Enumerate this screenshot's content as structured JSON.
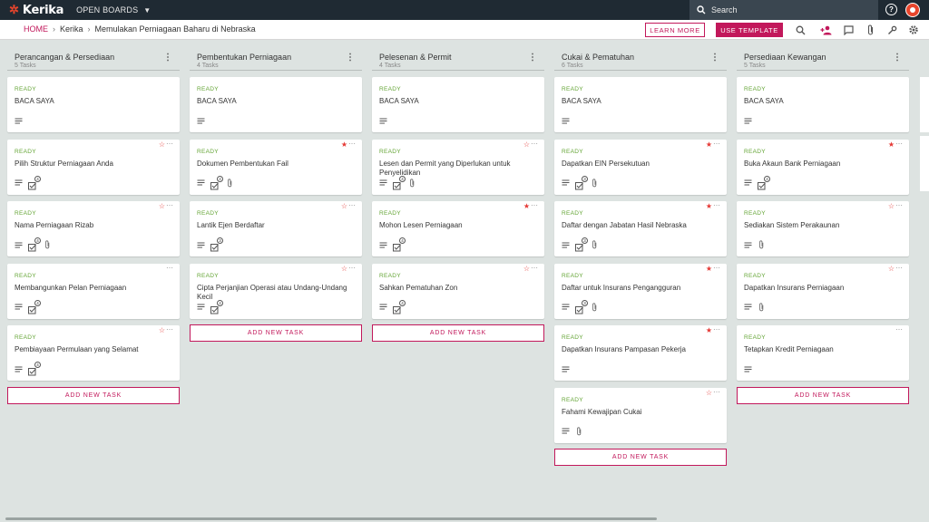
{
  "topbar": {
    "logo": "Kerika",
    "open_boards": "OPEN BOARDS",
    "search_label": "Search",
    "help": "?"
  },
  "breadcrumb": {
    "home": "HOME",
    "org": "Kerika",
    "board": "Memulakan Perniagaan Baharu di Nebraska"
  },
  "actions": {
    "learn_more": "LEARN MORE",
    "use_template": "USE TEMPLATE"
  },
  "add_label": "ADD NEW TASK",
  "columns": [
    {
      "title": "Perancangan & Persediaan",
      "count": "5 Tasks",
      "cards": [
        {
          "status": "READY",
          "title": "BACA SAYA",
          "star": "none",
          "checklist": "",
          "attach": false
        },
        {
          "status": "READY",
          "title": "Pilih Struktur Perniagaan Anda",
          "star": "outline",
          "checklist": "4",
          "attach": false
        },
        {
          "status": "READY",
          "title": "Nama Perniagaan Rizab",
          "star": "outline",
          "checklist": "4",
          "attach": true
        },
        {
          "status": "READY",
          "title": "Membangunkan Pelan Perniagaan",
          "star": "none",
          "checklist": "4",
          "attach": false
        },
        {
          "status": "READY",
          "title": "Pembiayaan Permulaan yang Selamat",
          "star": "outline",
          "checklist": "4",
          "attach": false
        }
      ]
    },
    {
      "title": "Pembentukan Perniagaan",
      "count": "4 Tasks",
      "cards": [
        {
          "status": "READY",
          "title": "BACA SAYA",
          "star": "none",
          "checklist": "",
          "attach": false
        },
        {
          "status": "READY",
          "title": "Dokumen Pembentukan Fail",
          "star": "filled",
          "checklist": "4",
          "attach": true
        },
        {
          "status": "READY",
          "title": "Lantik Ejen Berdaftar",
          "star": "outline",
          "checklist": "3",
          "attach": false
        },
        {
          "status": "READY",
          "title": "Cipta Perjanjian Operasi atau Undang-Undang Kecil",
          "star": "outline",
          "checklist": "4",
          "attach": false
        }
      ]
    },
    {
      "title": "Pelesenan & Permit",
      "count": "4 Tasks",
      "cards": [
        {
          "status": "READY",
          "title": "BACA SAYA",
          "star": "none",
          "checklist": "",
          "attach": false
        },
        {
          "status": "READY",
          "title": "Lesen dan Permit yang Diperlukan untuk Penyelidikan",
          "star": "outline",
          "checklist": "4",
          "attach": true
        },
        {
          "status": "READY",
          "title": "Mohon Lesen Perniagaan",
          "star": "filled",
          "checklist": "4",
          "attach": false
        },
        {
          "status": "READY",
          "title": "Sahkan Pematuhan Zon",
          "star": "outline",
          "checklist": "4",
          "attach": false
        }
      ]
    },
    {
      "title": "Cukai & Pematuhan",
      "count": "6 Tasks",
      "cards": [
        {
          "status": "READY",
          "title": "BACA SAYA",
          "star": "none",
          "checklist": "",
          "attach": false
        },
        {
          "status": "READY",
          "title": "Dapatkan EIN Persekutuan",
          "star": "filled",
          "checklist": "3",
          "attach": true
        },
        {
          "status": "READY",
          "title": "Daftar dengan Jabatan Hasil Nebraska",
          "star": "filled",
          "checklist": "3",
          "attach": true
        },
        {
          "status": "READY",
          "title": "Daftar untuk Insurans Pengangguran",
          "star": "filled",
          "checklist": "3",
          "attach": true
        },
        {
          "status": "READY",
          "title": "Dapatkan Insurans Pampasan Pekerja",
          "star": "filled",
          "checklist": "",
          "attach": false
        },
        {
          "status": "READY",
          "title": "Fahami Kewajipan Cukai",
          "star": "outline",
          "checklist": "",
          "attach": true
        }
      ]
    },
    {
      "title": "Persediaan Kewangan",
      "count": "5 Tasks",
      "cards": [
        {
          "status": "READY",
          "title": "BACA SAYA",
          "star": "none",
          "checklist": "",
          "attach": false
        },
        {
          "status": "READY",
          "title": "Buka Akaun Bank Perniagaan",
          "star": "filled",
          "checklist": "4",
          "attach": false
        },
        {
          "status": "READY",
          "title": "Sediakan Sistem Perakaunan",
          "star": "outline",
          "checklist": "",
          "attach": true
        },
        {
          "status": "READY",
          "title": "Dapatkan Insurans Perniagaan",
          "star": "outline",
          "checklist": "",
          "attach": true
        },
        {
          "status": "READY",
          "title": "Tetapkan Kredit Perniagaan",
          "star": "none",
          "checklist": "",
          "attach": false
        }
      ]
    }
  ],
  "colors": {
    "topbar": "#1f2a33",
    "accent": "#c2185b",
    "ready": "#64a536",
    "star": "#e53935",
    "board_bg": "#dde3e1"
  }
}
